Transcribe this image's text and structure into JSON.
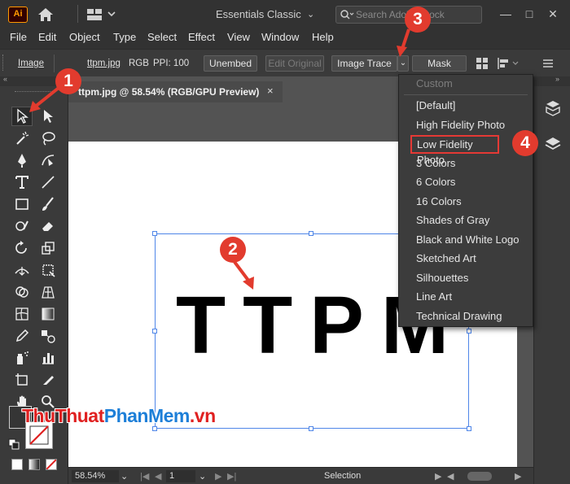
{
  "app": {
    "logo_text": "Ai"
  },
  "titlebar": {
    "workspace": "Essentials Classic",
    "search_placeholder": "Search Adobe Stock",
    "minimize": "—",
    "maximize": "□",
    "close": "✕"
  },
  "menu": [
    "File",
    "Edit",
    "Object",
    "Type",
    "Select",
    "Effect",
    "View",
    "Window",
    "Help"
  ],
  "controlbar": {
    "kind": "Image",
    "filename": "ttpm.jpg",
    "mode": "RGB",
    "ppi": "PPI: 100",
    "unembed": "Unembed",
    "edit_original": "Edit Original",
    "image_trace": "Image Trace",
    "mask": "Mask"
  },
  "document": {
    "tab_title": "ttpm.jpg @ 58.54% (RGB/GPU Preview)",
    "tab_close": "×",
    "artwork_text": "TTPM"
  },
  "statusbar": {
    "zoom": "58.54%",
    "artboard": "1",
    "tool_name": "Selection"
  },
  "dropdown": {
    "header": "Custom",
    "items": [
      "[Default]",
      "High Fidelity Photo",
      "Low Fidelity Photo",
      "3 Colors",
      "6 Colors",
      "16 Colors",
      "Shades of Gray",
      "Black and White Logo",
      "Sketched Art",
      "Silhouettes",
      "Line Art",
      "Technical Drawing"
    ],
    "highlighted": "Low Fidelity Photo"
  },
  "callouts": [
    "1",
    "2",
    "3",
    "4"
  ],
  "watermark": {
    "part1": "ThuThuat",
    "part2": "PhanMem",
    "part3": ".vn"
  },
  "colors": {
    "accent_red": "#e23b2e",
    "selection_blue": "#4f86e8",
    "panel_dark": "#323232",
    "panel_mid": "#3a3a3a"
  }
}
